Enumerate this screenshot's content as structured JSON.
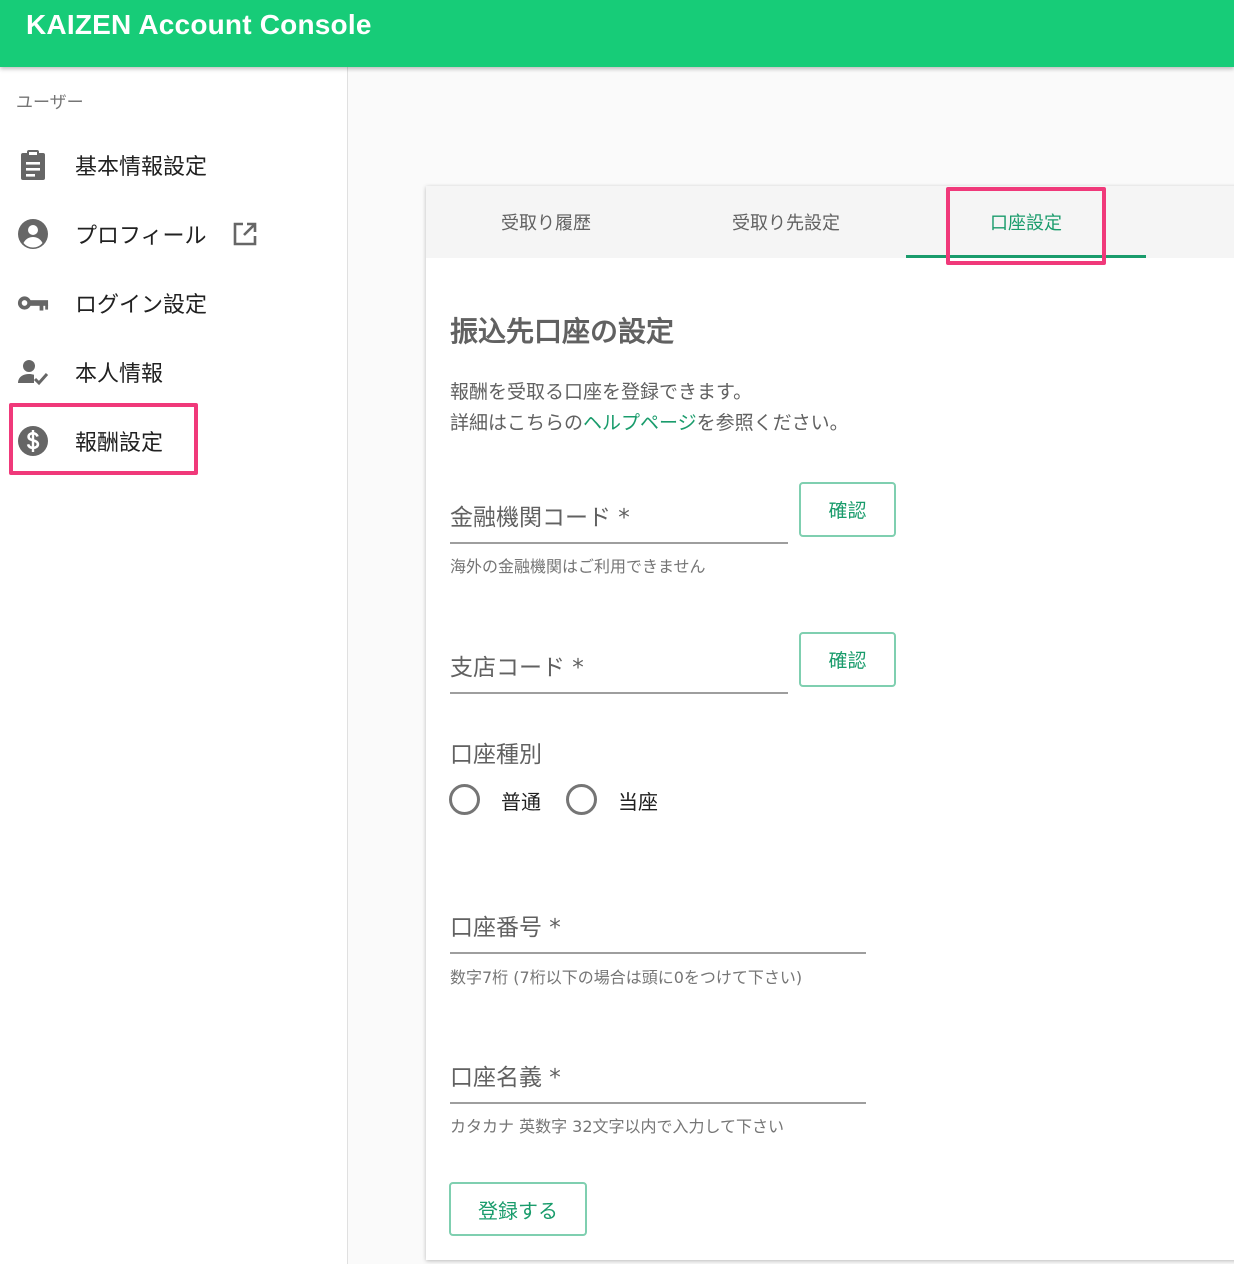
{
  "app": {
    "title": "KAIZEN Account Console"
  },
  "sidebar": {
    "heading": "ユーザー",
    "items": [
      {
        "label": "基本情報設定",
        "icon": "clipboard-icon"
      },
      {
        "label": "プロフィール",
        "icon": "account-circle-icon",
        "trailing_icon": "external-link-icon"
      },
      {
        "label": "ログイン設定",
        "icon": "key-icon"
      },
      {
        "label": "本人情報",
        "icon": "user-check-icon"
      },
      {
        "label": "報酬設定",
        "icon": "dollar-circle-icon",
        "selected": true
      }
    ]
  },
  "tabs": [
    {
      "label": "受取り履歴"
    },
    {
      "label": "受取り先設定"
    },
    {
      "label": "口座設定",
      "active": true
    }
  ],
  "content": {
    "title": "振込先口座の設定",
    "desc_line1": "報酬を受取る口座を登録できます。",
    "desc_line2_pre": "詳細はこちらの",
    "desc_line2_link": "ヘルプページ",
    "desc_line2_post": "を参照ください。",
    "bank_code": {
      "label": "金融機関コード *",
      "hint": "海外の金融機関はご利用できません",
      "confirm_label": "確認"
    },
    "branch_code": {
      "label": "支店コード *",
      "confirm_label": "確認"
    },
    "account_type": {
      "label": "口座種別",
      "options": [
        "普通",
        "当座"
      ]
    },
    "account_number": {
      "label": "口座番号 *",
      "hint": "数字7桁 (7桁以下の場合は頭に0をつけて下さい)"
    },
    "account_name": {
      "label": "口座名義 *",
      "hint": "カタカナ 英数字 32文字以内で入力して下さい"
    },
    "submit_label": "登録する"
  },
  "colors": {
    "appbar": "#17cc78",
    "accent": "#1a9c6c",
    "highlight": "#f0397a"
  }
}
